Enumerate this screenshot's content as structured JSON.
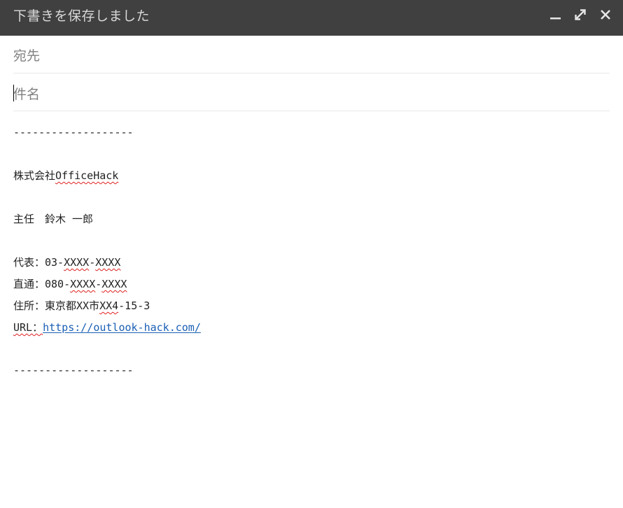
{
  "window": {
    "title": "下書きを保存しました"
  },
  "fields": {
    "to_label": "宛先",
    "subject_label": "件名"
  },
  "signature": {
    "separator_top": "-------------------",
    "company_prefix": "株式会社",
    "company_name": "OfficeHack",
    "position_name": "主任　鈴木 一郎",
    "rep_label": "代表：03-",
    "rep_part1": "XXXX",
    "rep_dash": "-",
    "rep_part2": "XXXX",
    "direct_label": "直通：080-",
    "direct_part1": "XXXX",
    "direct_dash": "-",
    "direct_part2": "XXXX",
    "address_prefix": "住所：東京都XX市",
    "address_underlined": "XX4",
    "address_suffix": "-15-3",
    "url_label": "URL：",
    "url_link": "https://outlook-hack.com/",
    "separator_bottom": "-------------------"
  },
  "colors": {
    "titlebar": "#404040",
    "title_text": "#d8d8d8",
    "link": "#1a5fb4",
    "spell_underline": "#e02020"
  },
  "icons": [
    "minimize-icon",
    "pop-out-icon",
    "close-icon"
  ]
}
